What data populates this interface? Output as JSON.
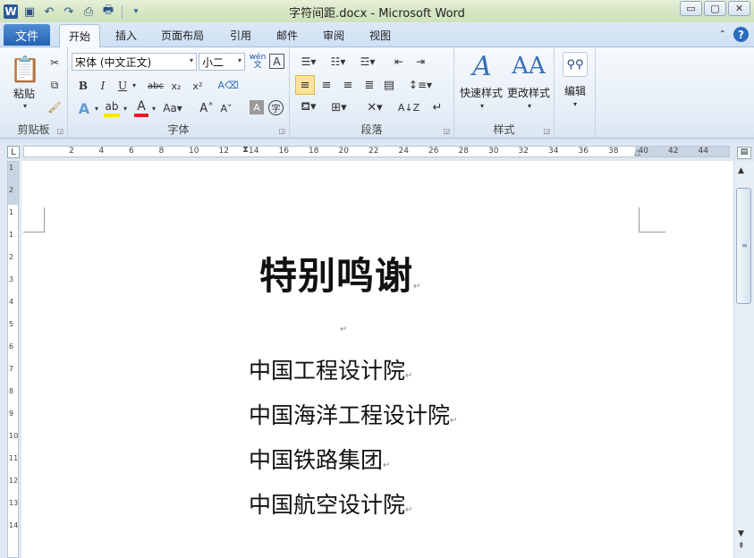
{
  "window": {
    "title": "字符间距.docx - Microsoft Word",
    "app_icon_letter": "W",
    "controls": {
      "minimize": "▭",
      "maximize": "▢",
      "close": "✕"
    }
  },
  "tabs": {
    "file": "文件",
    "items": [
      "开始",
      "插入",
      "页面布局",
      "引用",
      "邮件",
      "审阅",
      "视图"
    ],
    "active": "开始"
  },
  "ribbon": {
    "clipboard": {
      "label": "剪贴板",
      "paste": "粘贴"
    },
    "font": {
      "label": "字体",
      "font_name": "宋体 (中文正文)",
      "font_size": "小二",
      "wen": "wén\n文"
    },
    "paragraph": {
      "label": "段落"
    },
    "styles": {
      "label": "样式",
      "quick_styles": "快速样式",
      "change_styles": "更改样式"
    },
    "editing": {
      "label": "编辑"
    }
  },
  "ruler": {
    "numbers": [
      "2",
      "4",
      "6",
      "8",
      "10",
      "12",
      "14",
      "16",
      "18",
      "20",
      "22",
      "24",
      "26",
      "28",
      "30",
      "32",
      "34",
      "36",
      "38",
      "40",
      "42",
      "44"
    ],
    "vnumbers": [
      "1",
      "2",
      "1",
      "1",
      "2",
      "3",
      "4",
      "5",
      "6",
      "7",
      "8",
      "9",
      "10",
      "11",
      "12",
      "13",
      "14"
    ]
  },
  "document": {
    "title": "特别鸣谢",
    "lines": [
      "中国工程设计院",
      "中国海洋工程设计院",
      "中国铁路集团",
      "中国航空设计院"
    ],
    "paragraph_mark": "↵"
  }
}
